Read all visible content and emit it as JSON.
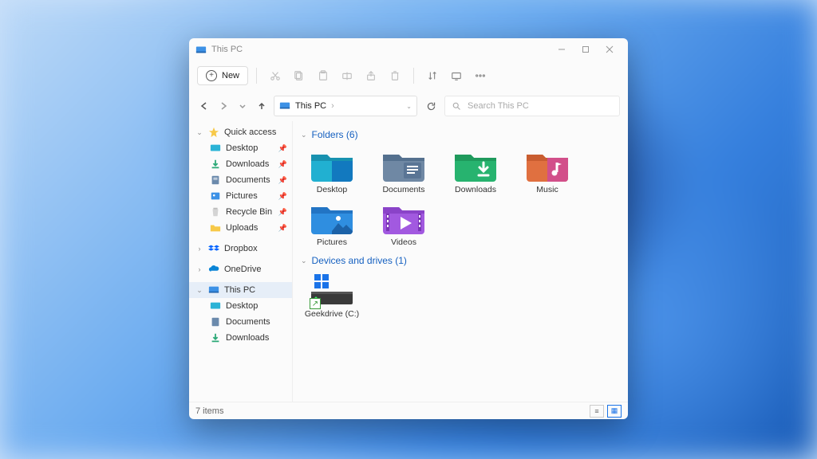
{
  "titlebar": {
    "title": "This PC"
  },
  "toolbar": {
    "new_label": "New"
  },
  "address": {
    "location": "This PC",
    "separator": "›"
  },
  "search": {
    "placeholder": "Search This PC"
  },
  "sidebar": {
    "quick_access": "Quick access",
    "desktop": "Desktop",
    "downloads": "Downloads",
    "documents": "Documents",
    "pictures": "Pictures",
    "recycle_bin": "Recycle Bin",
    "uploads": "Uploads",
    "dropbox": "Dropbox",
    "onedrive": "OneDrive",
    "this_pc": "This PC",
    "pc_desktop": "Desktop",
    "pc_documents": "Documents",
    "pc_downloads": "Downloads"
  },
  "groups": {
    "folders_header": "Folders (6)",
    "drives_header": "Devices and drives (1)"
  },
  "folders": {
    "desktop": "Desktop",
    "documents": "Documents",
    "downloads": "Downloads",
    "music": "Music",
    "pictures": "Pictures",
    "videos": "Videos"
  },
  "drives": {
    "c": "Geekdrive (C:)"
  },
  "status": {
    "count": "7 items"
  }
}
